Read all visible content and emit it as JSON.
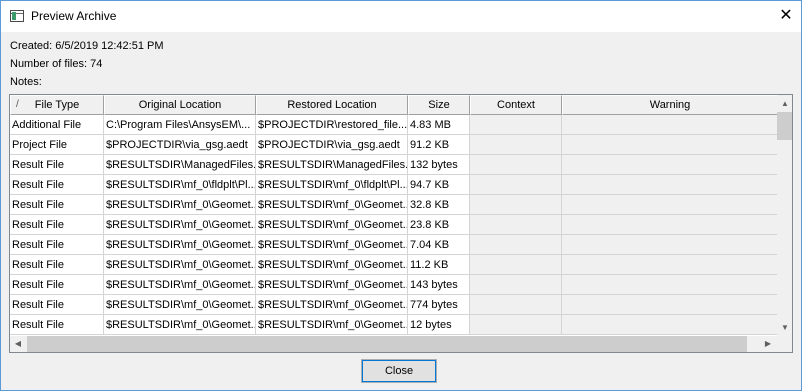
{
  "window": {
    "title": "Preview Archive",
    "close_glyph": "✕"
  },
  "info": {
    "created": "Created: 6/5/2019 12:42:51 PM",
    "num_files": "Number of files: 74",
    "notes": "Notes:"
  },
  "table": {
    "sort_indicator": "/",
    "headers": [
      "File Type",
      "Original Location",
      "Restored Location",
      "Size",
      "Context",
      "Warning"
    ],
    "rows": [
      [
        "Additional File",
        "C:\\Program Files\\AnsysEM\\...",
        "$PROJECTDIR\\restored_file...",
        "4.83 MB",
        "",
        ""
      ],
      [
        "Project File",
        "$PROJECTDIR\\via_gsg.aedt",
        "$PROJECTDIR\\via_gsg.aedt",
        "91.2 KB",
        "",
        ""
      ],
      [
        "Result File",
        "$RESULTSDIR\\ManagedFiles...",
        "$RESULTSDIR\\ManagedFiles...",
        "132 bytes",
        "",
        ""
      ],
      [
        "Result File",
        "$RESULTSDIR\\mf_0\\fldplt\\Pl...",
        "$RESULTSDIR\\mf_0\\fldplt\\Pl...",
        "94.7 KB",
        "",
        ""
      ],
      [
        "Result File",
        "$RESULTSDIR\\mf_0\\Geomet...",
        "$RESULTSDIR\\mf_0\\Geomet...",
        "32.8 KB",
        "",
        ""
      ],
      [
        "Result File",
        "$RESULTSDIR\\mf_0\\Geomet...",
        "$RESULTSDIR\\mf_0\\Geomet...",
        "23.8 KB",
        "",
        ""
      ],
      [
        "Result File",
        "$RESULTSDIR\\mf_0\\Geomet...",
        "$RESULTSDIR\\mf_0\\Geomet...",
        "7.04 KB",
        "",
        ""
      ],
      [
        "Result File",
        "$RESULTSDIR\\mf_0\\Geomet...",
        "$RESULTSDIR\\mf_0\\Geomet...",
        "11.2 KB",
        "",
        ""
      ],
      [
        "Result File",
        "$RESULTSDIR\\mf_0\\Geomet...",
        "$RESULTSDIR\\mf_0\\Geomet...",
        "143 bytes",
        "",
        ""
      ],
      [
        "Result File",
        "$RESULTSDIR\\mf_0\\Geomet...",
        "$RESULTSDIR\\mf_0\\Geomet...",
        "774 bytes",
        "",
        ""
      ],
      [
        "Result File",
        "$RESULTSDIR\\mf_0\\Geomet...",
        "$RESULTSDIR\\mf_0\\Geomet...",
        "12 bytes",
        "",
        ""
      ]
    ]
  },
  "scroll": {
    "up": "▲",
    "down": "▼",
    "left": "◀",
    "right": "▶"
  },
  "buttons": {
    "close_label": "Close"
  }
}
